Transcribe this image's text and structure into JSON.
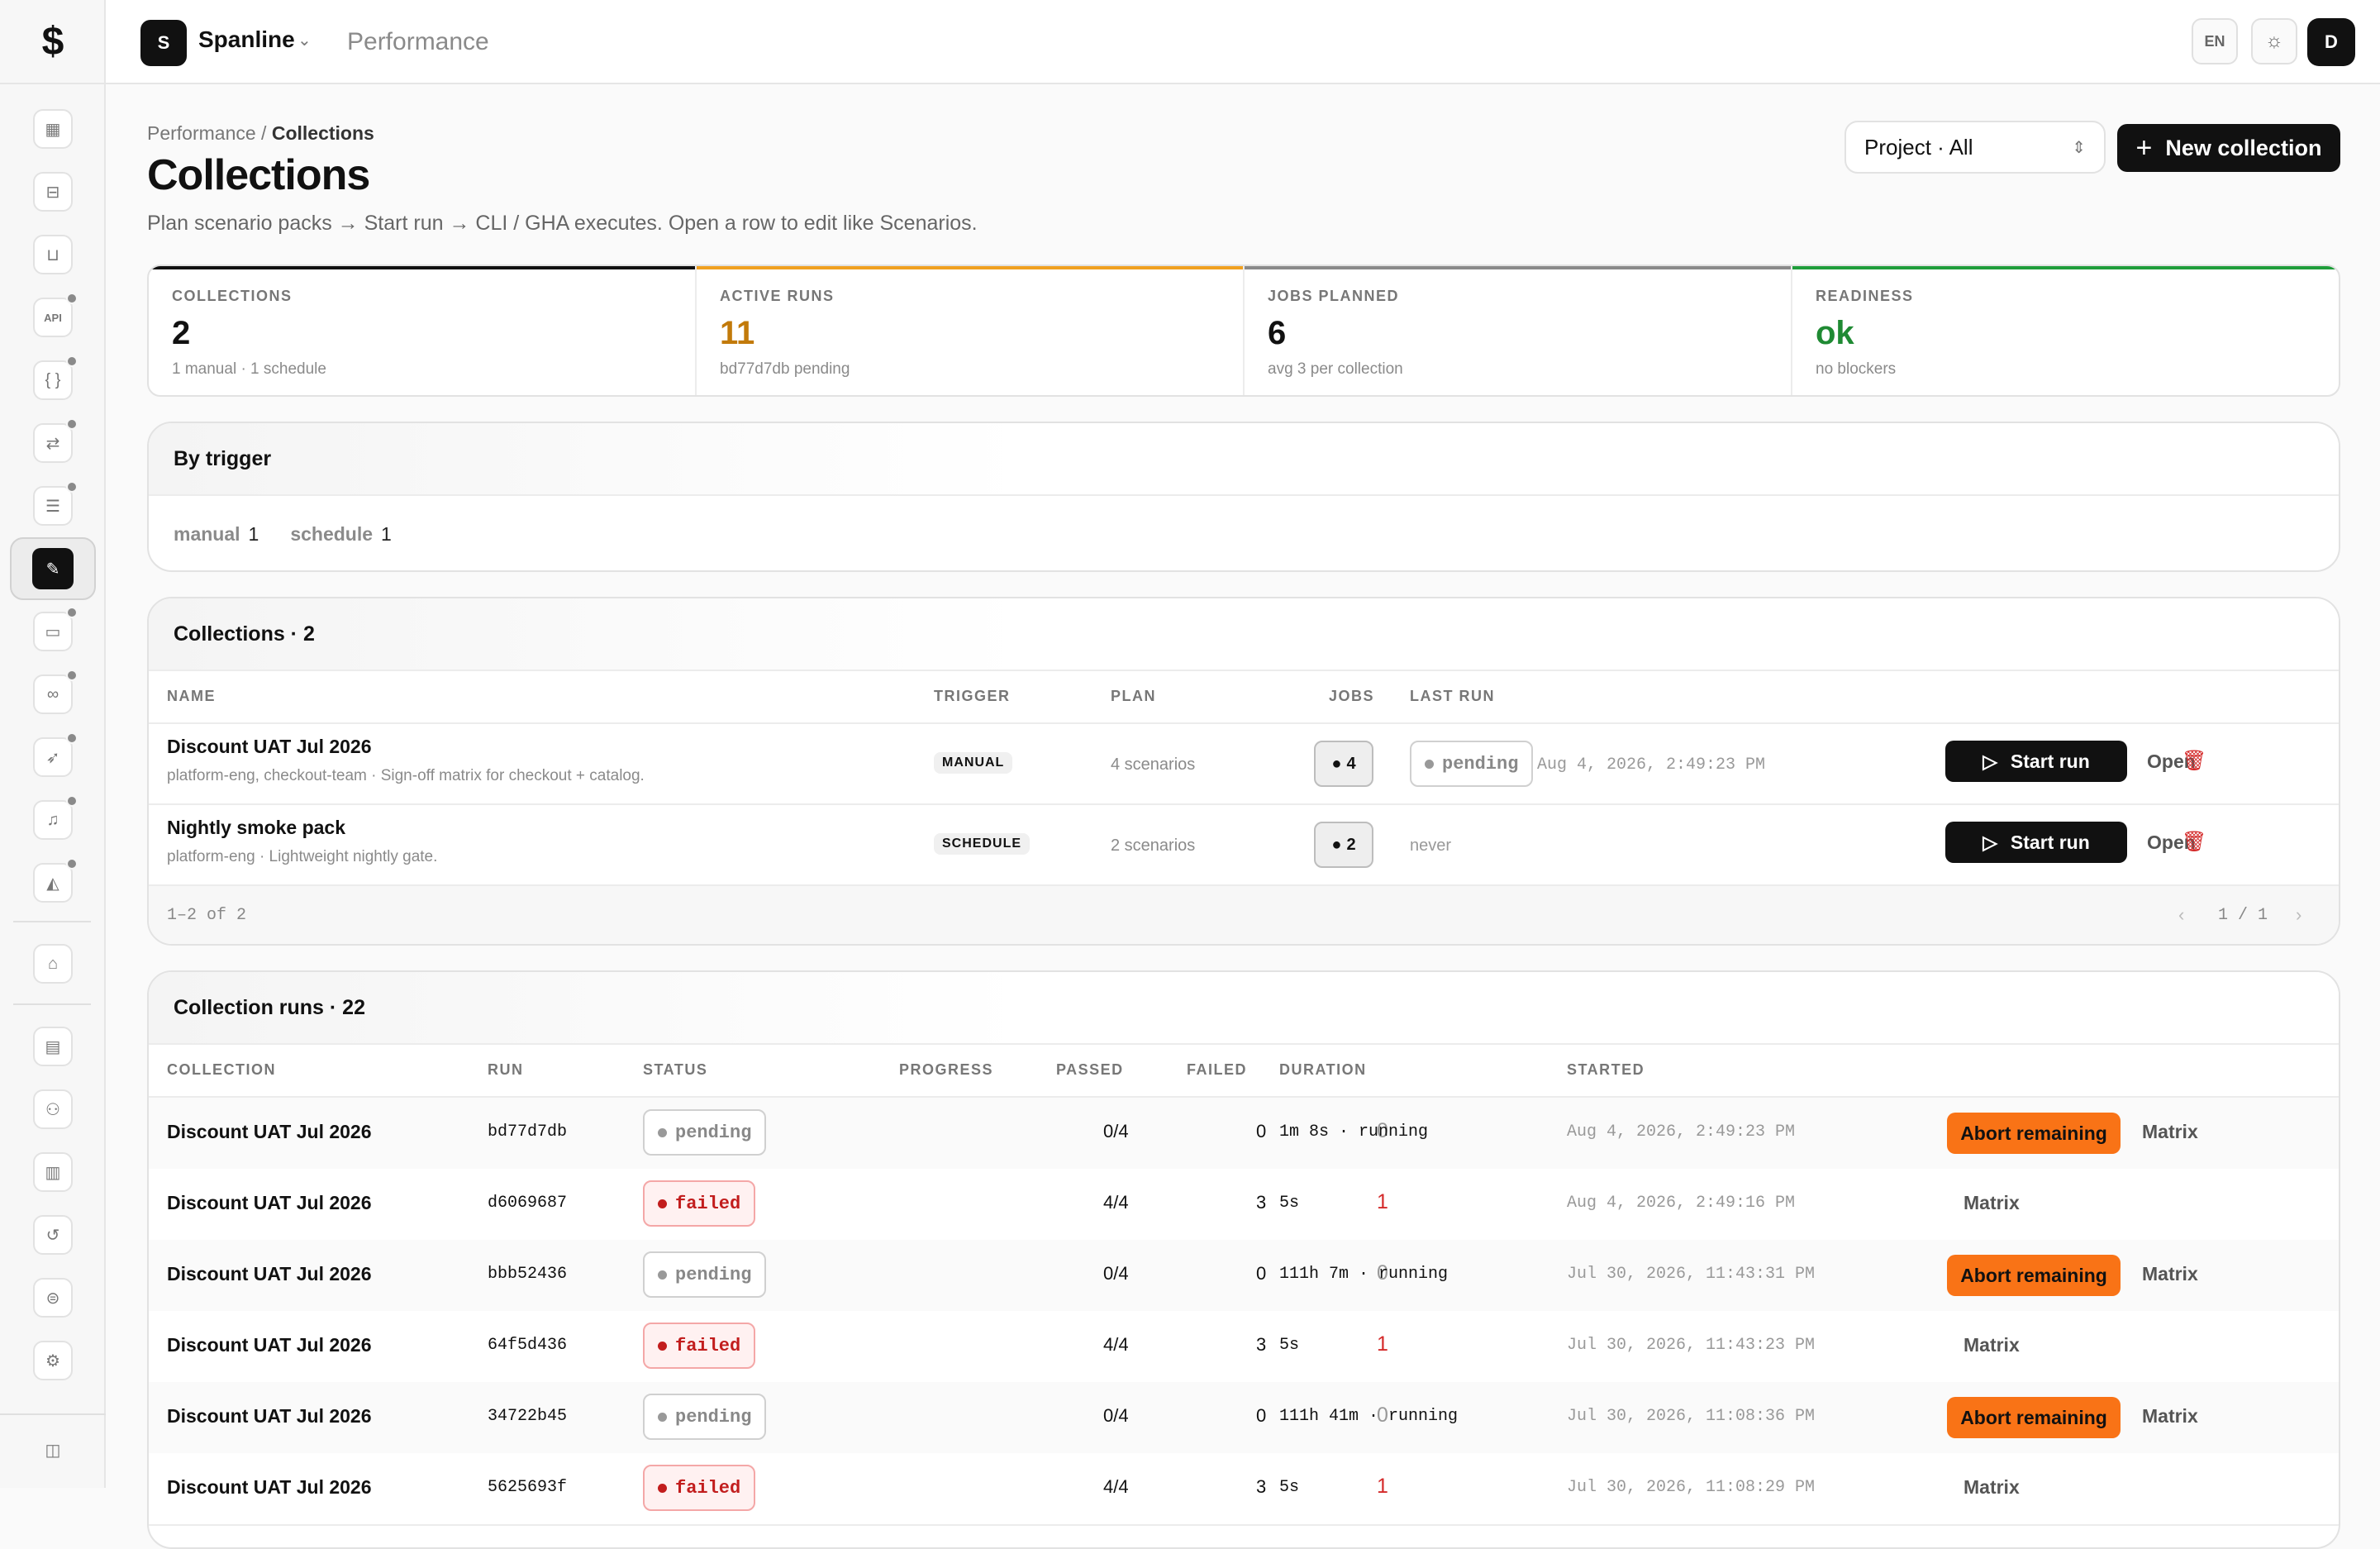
{
  "app": {
    "logo": "$",
    "org_initial": "S",
    "org_name": "Spanline",
    "section": "Performance",
    "lang": "EN",
    "user_initial": "D"
  },
  "breadcrumb": {
    "parent": "Performance",
    "sep": " / ",
    "current": "Collections"
  },
  "page": {
    "title": "Collections",
    "subtitle": "Plan scenario packs → Start run → CLI / GHA executes. Open a row to edit like Scenarios."
  },
  "toolbar": {
    "project_select": "Project · All",
    "new_label": "New collection"
  },
  "stats": [
    {
      "label": "COLLECTIONS",
      "value": "2",
      "sub": "1 manual · 1 schedule",
      "accent": "#111111",
      "value_color": "#111111"
    },
    {
      "label": "ACTIVE RUNS",
      "value": "11",
      "sub": "bd77d7db pending",
      "accent": "#f0a020",
      "value_color": "#c27a0a"
    },
    {
      "label": "JOBS PLANNED",
      "value": "6",
      "sub": "avg 3 per collection",
      "accent": "#8a8a8a",
      "value_color": "#111111"
    },
    {
      "label": "READINESS",
      "value": "ok",
      "sub": "no blockers",
      "accent": "#1f9d3a",
      "value_color": "#1f8a33"
    }
  ],
  "by_trigger": {
    "title": "By trigger",
    "items": [
      {
        "k": "manual",
        "v": "1"
      },
      {
        "k": "schedule",
        "v": "1"
      }
    ]
  },
  "collections": {
    "title": "Collections · 2",
    "headers": {
      "name": "NAME",
      "trigger": "TRIGGER",
      "plan": "PLAN",
      "jobs": "JOBS",
      "last_run": "LAST RUN"
    },
    "rows": [
      {
        "name": "Discount UAT Jul 2026",
        "meta": "platform-eng, checkout-team · Sign-off matrix for checkout + catalog.",
        "trigger": "MANUAL",
        "plan": "4 scenarios",
        "jobs": "4",
        "last_status": "pending",
        "last_time": "Aug 4, 2026, 2:49:23 PM",
        "start": "Start run",
        "open": "Open"
      },
      {
        "name": "Nightly smoke pack",
        "meta": "platform-eng · Lightweight nightly gate.",
        "trigger": "SCHEDULE",
        "plan": "2 scenarios",
        "jobs": "2",
        "last_status": "",
        "last_time": "never",
        "start": "Start run",
        "open": "Open"
      }
    ],
    "footer": {
      "range": "1–2 of 2",
      "page": "1 / 1"
    }
  },
  "runs": {
    "title": "Collection runs · 22",
    "headers": {
      "collection": "COLLECTION",
      "run": "RUN",
      "status": "STATUS",
      "progress": "PROGRESS",
      "passed": "PASSED",
      "failed": "FAILED",
      "duration": "DURATION",
      "started": "STARTED"
    },
    "abort_label": "Abort remaining",
    "matrix_label": "Matrix",
    "rows": [
      {
        "collection": "Discount UAT Jul 2026",
        "run": "bd77d7db",
        "status": "pending",
        "progress": "0/4",
        "passed": "0",
        "failed": "0",
        "duration": "1m 8s · running",
        "started": "Aug 4, 2026, 2:49:23 PM",
        "abort": true
      },
      {
        "collection": "Discount UAT Jul 2026",
        "run": "d6069687",
        "status": "failed",
        "progress": "4/4",
        "passed": "3",
        "failed": "1",
        "duration": "5s",
        "started": "Aug 4, 2026, 2:49:16 PM",
        "abort": false
      },
      {
        "collection": "Discount UAT Jul 2026",
        "run": "bbb52436",
        "status": "pending",
        "progress": "0/4",
        "passed": "0",
        "failed": "0",
        "duration": "111h 7m · running",
        "started": "Jul 30, 2026, 11:43:31 PM",
        "abort": true
      },
      {
        "collection": "Discount UAT Jul 2026",
        "run": "64f5d436",
        "status": "failed",
        "progress": "4/4",
        "passed": "3",
        "failed": "1",
        "duration": "5s",
        "started": "Jul 30, 2026, 11:43:23 PM",
        "abort": false
      },
      {
        "collection": "Discount UAT Jul 2026",
        "run": "34722b45",
        "status": "pending",
        "progress": "0/4",
        "passed": "0",
        "failed": "0",
        "duration": "111h 41m · running",
        "started": "Jul 30, 2026, 11:08:36 PM",
        "abort": true
      },
      {
        "collection": "Discount UAT Jul 2026",
        "run": "5625693f",
        "status": "failed",
        "progress": "4/4",
        "passed": "3",
        "failed": "1",
        "duration": "5s",
        "started": "Jul 30, 2026, 11:08:29 PM",
        "abort": false
      }
    ]
  },
  "sidebar_icons": [
    "grid-icon",
    "briefcase-icon",
    "inbox-icon",
    "api-icon",
    "braces-icon",
    "route-icon",
    "checklist-icon",
    "wand-icon",
    "ticket-icon",
    "link-icon",
    "rocket-icon",
    "bell-icon",
    "chart-icon",
    "building-icon",
    "ledger-icon",
    "users-icon",
    "report-icon",
    "history-icon",
    "storage-icon",
    "gear-icon",
    "panel-toggle-icon"
  ]
}
